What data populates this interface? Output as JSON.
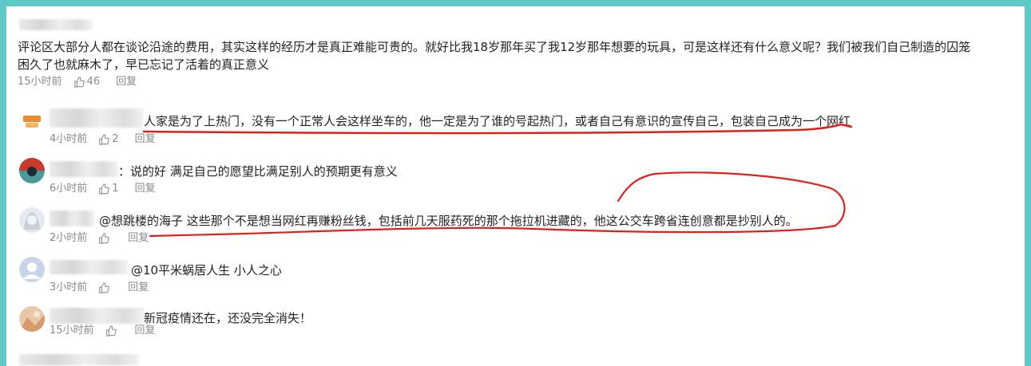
{
  "main_comment": {
    "text_line1": "评论区大部分人都在谈论沿途的费用，其实这样的经历才是真正难能可贵的。就好比我18岁那年买了我12岁那年想要的玩具，可是这样还有什么意义呢？我们被我们自己制造的囚笼",
    "text_line2": "困久了也就麻木了，早已忘记了活着的真正意义",
    "time": "15小时前",
    "likes": "46",
    "reply_label": "回复"
  },
  "replies": [
    {
      "text": "人家是为了上热门，没有一个正常人会这样坐车的，他一定是为了谁的号起热门，或者自己有意识的宣传自己，包装自己成为一个网红",
      "time": "4小时前",
      "likes": "2",
      "reply_label": "回复",
      "avatar_icon": "cartoon-avatar-icon"
    },
    {
      "text": "：说的好 满足自己的愿望比满足别人的预期更有意义",
      "time": "6小时前",
      "likes": "1",
      "reply_label": "回复",
      "avatar_icon": "sunset-avatar-icon"
    },
    {
      "text": "@想跳楼的海子 这些那个不是想当网红再赚粉丝钱，包括前几天服药死的那个拖拉机进藏的，他这公交车跨省连创意都是抄别人的。",
      "time": "2小时前",
      "likes": "",
      "reply_label": "回复",
      "avatar_icon": "anime-avatar-icon"
    },
    {
      "text": "@10平米蜗居人生 小人之心",
      "time": "3小时前",
      "likes": "",
      "reply_label": "回复",
      "avatar_icon": "default-avatar-icon"
    },
    {
      "text": "新冠疫情还在，还没完全消失！",
      "time": "15小时前",
      "likes": "",
      "reply_label": "回复",
      "avatar_icon": "photo-avatar-icon"
    }
  ],
  "colors": {
    "background": "#5fc9c5",
    "annotation": "#e0201b",
    "meta_text": "#8a8a8a"
  }
}
